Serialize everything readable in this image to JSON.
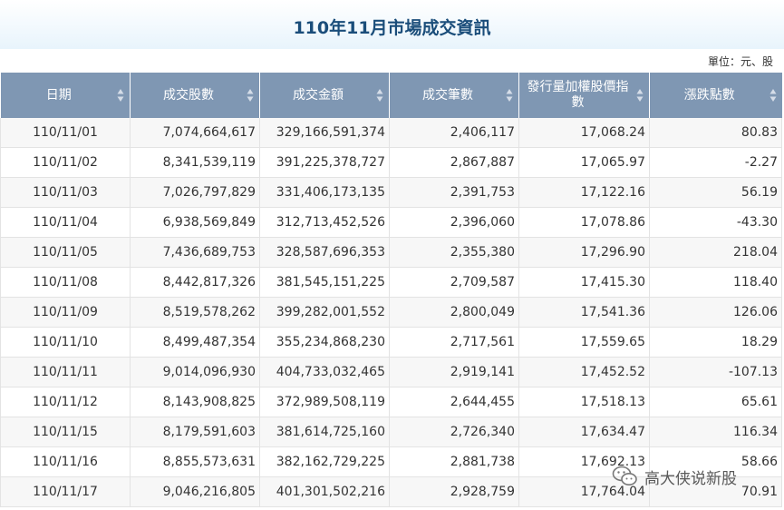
{
  "page": {
    "title": "110年11月市場成交資訊",
    "unit_label": "單位：元、股"
  },
  "table": {
    "columns": [
      {
        "label": "日期"
      },
      {
        "label": "成交股數"
      },
      {
        "label": "成交金額"
      },
      {
        "label": "成交筆數"
      },
      {
        "label": "發行量加權股價指數"
      },
      {
        "label": "漲跌點數"
      }
    ],
    "rows": [
      {
        "date": "110/11/01",
        "shares": "7,074,664,617",
        "amount": "329,166,591,374",
        "trades": "2,406,117",
        "index": "17,068.24",
        "change": "80.83"
      },
      {
        "date": "110/11/02",
        "shares": "8,341,539,119",
        "amount": "391,225,378,727",
        "trades": "2,867,887",
        "index": "17,065.97",
        "change": "-2.27"
      },
      {
        "date": "110/11/03",
        "shares": "7,026,797,829",
        "amount": "331,406,173,135",
        "trades": "2,391,753",
        "index": "17,122.16",
        "change": "56.19"
      },
      {
        "date": "110/11/04",
        "shares": "6,938,569,849",
        "amount": "312,713,452,526",
        "trades": "2,396,060",
        "index": "17,078.86",
        "change": "-43.30"
      },
      {
        "date": "110/11/05",
        "shares": "7,436,689,753",
        "amount": "328,587,696,353",
        "trades": "2,355,380",
        "index": "17,296.90",
        "change": "218.04"
      },
      {
        "date": "110/11/08",
        "shares": "8,442,817,326",
        "amount": "381,545,151,225",
        "trades": "2,709,587",
        "index": "17,415.30",
        "change": "118.40"
      },
      {
        "date": "110/11/09",
        "shares": "8,519,578,262",
        "amount": "399,282,001,552",
        "trades": "2,800,049",
        "index": "17,541.36",
        "change": "126.06"
      },
      {
        "date": "110/11/10",
        "shares": "8,499,487,354",
        "amount": "355,234,868,230",
        "trades": "2,717,561",
        "index": "17,559.65",
        "change": "18.29"
      },
      {
        "date": "110/11/11",
        "shares": "9,014,096,930",
        "amount": "404,733,032,465",
        "trades": "2,919,141",
        "index": "17,452.52",
        "change": "-107.13"
      },
      {
        "date": "110/11/12",
        "shares": "8,143,908,825",
        "amount": "372,989,508,119",
        "trades": "2,644,455",
        "index": "17,518.13",
        "change": "65.61"
      },
      {
        "date": "110/11/15",
        "shares": "8,179,591,603",
        "amount": "381,614,725,160",
        "trades": "2,726,340",
        "index": "17,634.47",
        "change": "116.34"
      },
      {
        "date": "110/11/16",
        "shares": "8,855,573,631",
        "amount": "382,162,729,225",
        "trades": "2,881,738",
        "index": "17,692.13",
        "change": "58.66"
      },
      {
        "date": "110/11/17",
        "shares": "9,046,216,805",
        "amount": "401,301,502,216",
        "trades": "2,928,759",
        "index": "17,764.04",
        "change": "70.91"
      }
    ]
  },
  "watermark": {
    "text": "高大侠说新股",
    "icon": "wechat-icon"
  },
  "colors": {
    "header_bg": "#7f97b3",
    "title_color": "#1a4d7a",
    "stripe": "#f7f7f7"
  }
}
